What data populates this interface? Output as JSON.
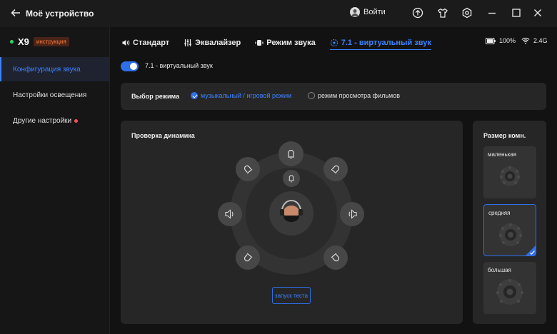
{
  "titlebar": {
    "title": "Моё устройство",
    "login_label": "Войти"
  },
  "device": {
    "name": "X9",
    "badge": "инструкция"
  },
  "sidebar": {
    "items": [
      {
        "label": "Конфигурация звука",
        "active": true
      },
      {
        "label": "Настройки освещения",
        "active": false
      },
      {
        "label": "Другие настройки",
        "active": false,
        "notification": true
      }
    ]
  },
  "tabs": [
    {
      "label": "Стандарт",
      "icon": "speaker-icon"
    },
    {
      "label": "Эквалайзер",
      "icon": "equalizer-icon"
    },
    {
      "label": "Режим звука",
      "icon": "sound-mode-icon"
    },
    {
      "label": "7.1 - виртуальный звук",
      "icon": "surround-icon",
      "active": true
    }
  ],
  "status": {
    "battery": "100%",
    "connection": "2.4G"
  },
  "virtual_sound": {
    "toggle_label": "7.1 - виртуальный звук",
    "enabled": true
  },
  "mode": {
    "label": "Выбор режима",
    "options": [
      {
        "label": "музыкальный / игровой режим",
        "checked": true
      },
      {
        "label": "режим просмотра фильмов",
        "checked": false
      }
    ]
  },
  "speaker_test": {
    "title": "Проверка динамика",
    "button_label": "запуск теста"
  },
  "room_size": {
    "title": "Размер комн.",
    "options": [
      {
        "label": "маленькая",
        "selected": false
      },
      {
        "label": "средняя",
        "selected": true
      },
      {
        "label": "большая",
        "selected": false
      }
    ]
  },
  "colors": {
    "accent": "#3b82ff",
    "background": "#121212",
    "panel": "#262626",
    "badge_text": "#ff7a3c",
    "online_dot": "#2fd36b",
    "notification_dot": "#ff4d5a"
  }
}
